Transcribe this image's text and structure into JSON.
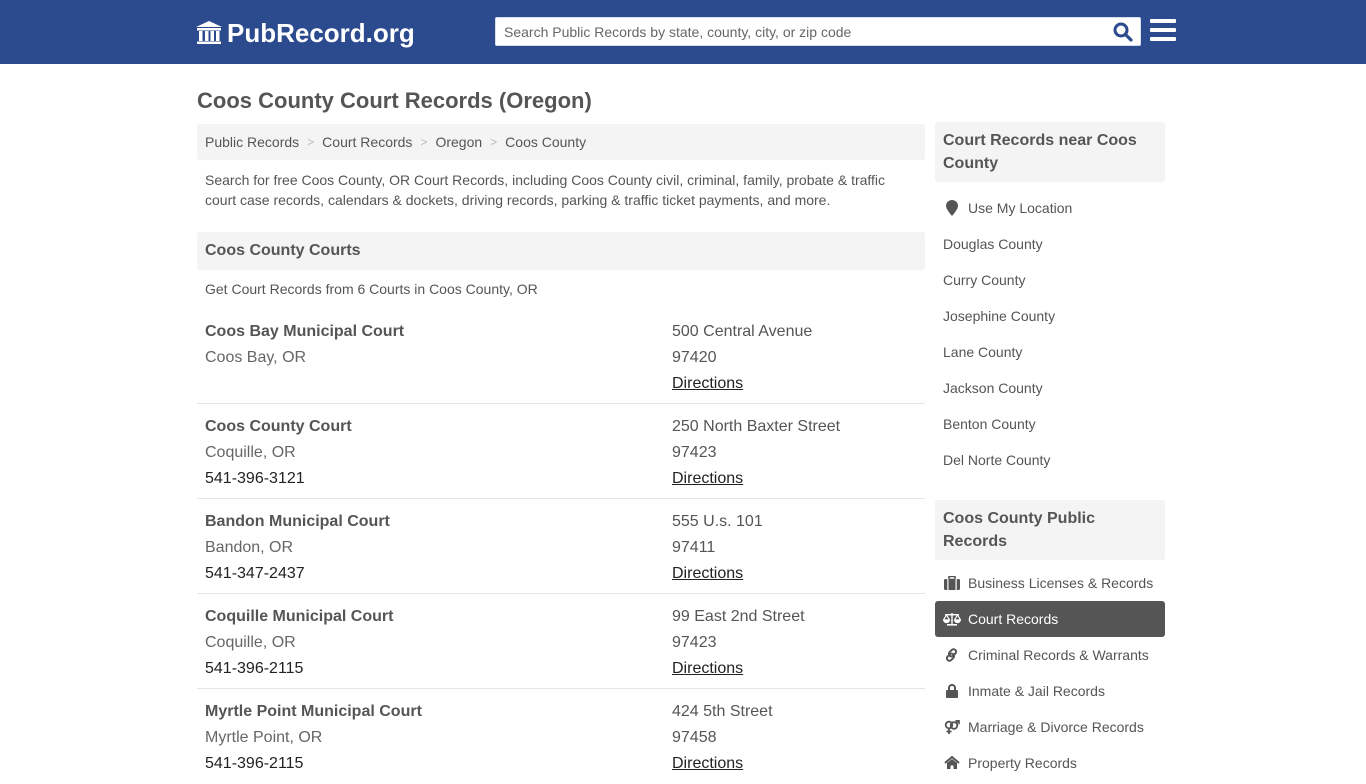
{
  "header": {
    "logo_text": "PubRecord.org",
    "search_placeholder": "Search Public Records by state, county, city, or zip code",
    "search_value": "",
    "brand_color": "#2c4a8e"
  },
  "page": {
    "title": "Coos County Court Records (Oregon)",
    "breadcrumb": [
      "Public Records",
      "Court Records",
      "Oregon",
      "Coos County"
    ],
    "intro": "Search for free Coos County, OR Court Records, including Coos County civil, criminal, family, probate & traffic court case records, calendars & dockets, driving records, parking & traffic ticket payments, and more."
  },
  "courts": {
    "heading": "Coos County Courts",
    "subheading": "Get Court Records from 6 Courts in Coos County, OR",
    "items": [
      {
        "name": "Coos Bay Municipal Court",
        "city": "Coos Bay, OR",
        "phone": "",
        "address": "500 Central Avenue",
        "zip": "97420",
        "link": "Directions"
      },
      {
        "name": "Coos County Court",
        "city": "Coquille, OR",
        "phone": "541-396-3121",
        "address": "250 North Baxter Street",
        "zip": "97423",
        "link": "Directions"
      },
      {
        "name": "Bandon Municipal Court",
        "city": "Bandon, OR",
        "phone": "541-347-2437",
        "address": "555 U.s. 101",
        "zip": "97411",
        "link": "Directions"
      },
      {
        "name": "Coquille Municipal Court",
        "city": "Coquille, OR",
        "phone": "541-396-2115",
        "address": "99 East 2nd Street",
        "zip": "97423",
        "link": "Directions"
      },
      {
        "name": "Myrtle Point Municipal Court",
        "city": "Myrtle Point, OR",
        "phone": "541-396-2115",
        "address": "424 5th Street",
        "zip": "97458",
        "link": "Directions"
      }
    ]
  },
  "sidebar_nearby": {
    "heading": "Court Records near Coos County",
    "items": [
      {
        "label": "Use My Location",
        "icon": "map-marker-icon"
      },
      {
        "label": "Douglas County"
      },
      {
        "label": "Curry County"
      },
      {
        "label": "Josephine County"
      },
      {
        "label": "Lane County"
      },
      {
        "label": "Jackson County"
      },
      {
        "label": "Benton County"
      },
      {
        "label": "Del Norte County"
      }
    ]
  },
  "sidebar_public": {
    "heading": "Coos County Public Records",
    "active_index": 1,
    "items": [
      {
        "label": "Business Licenses & Records",
        "icon": "briefcase-icon"
      },
      {
        "label": "Court Records",
        "icon": "balance-scale-icon"
      },
      {
        "label": "Criminal Records & Warrants",
        "icon": "link-icon"
      },
      {
        "label": "Inmate & Jail Records",
        "icon": "lock-icon"
      },
      {
        "label": "Marriage & Divorce Records",
        "icon": "venus-mars-icon"
      },
      {
        "label": "Property Records",
        "icon": "home-icon"
      }
    ]
  }
}
